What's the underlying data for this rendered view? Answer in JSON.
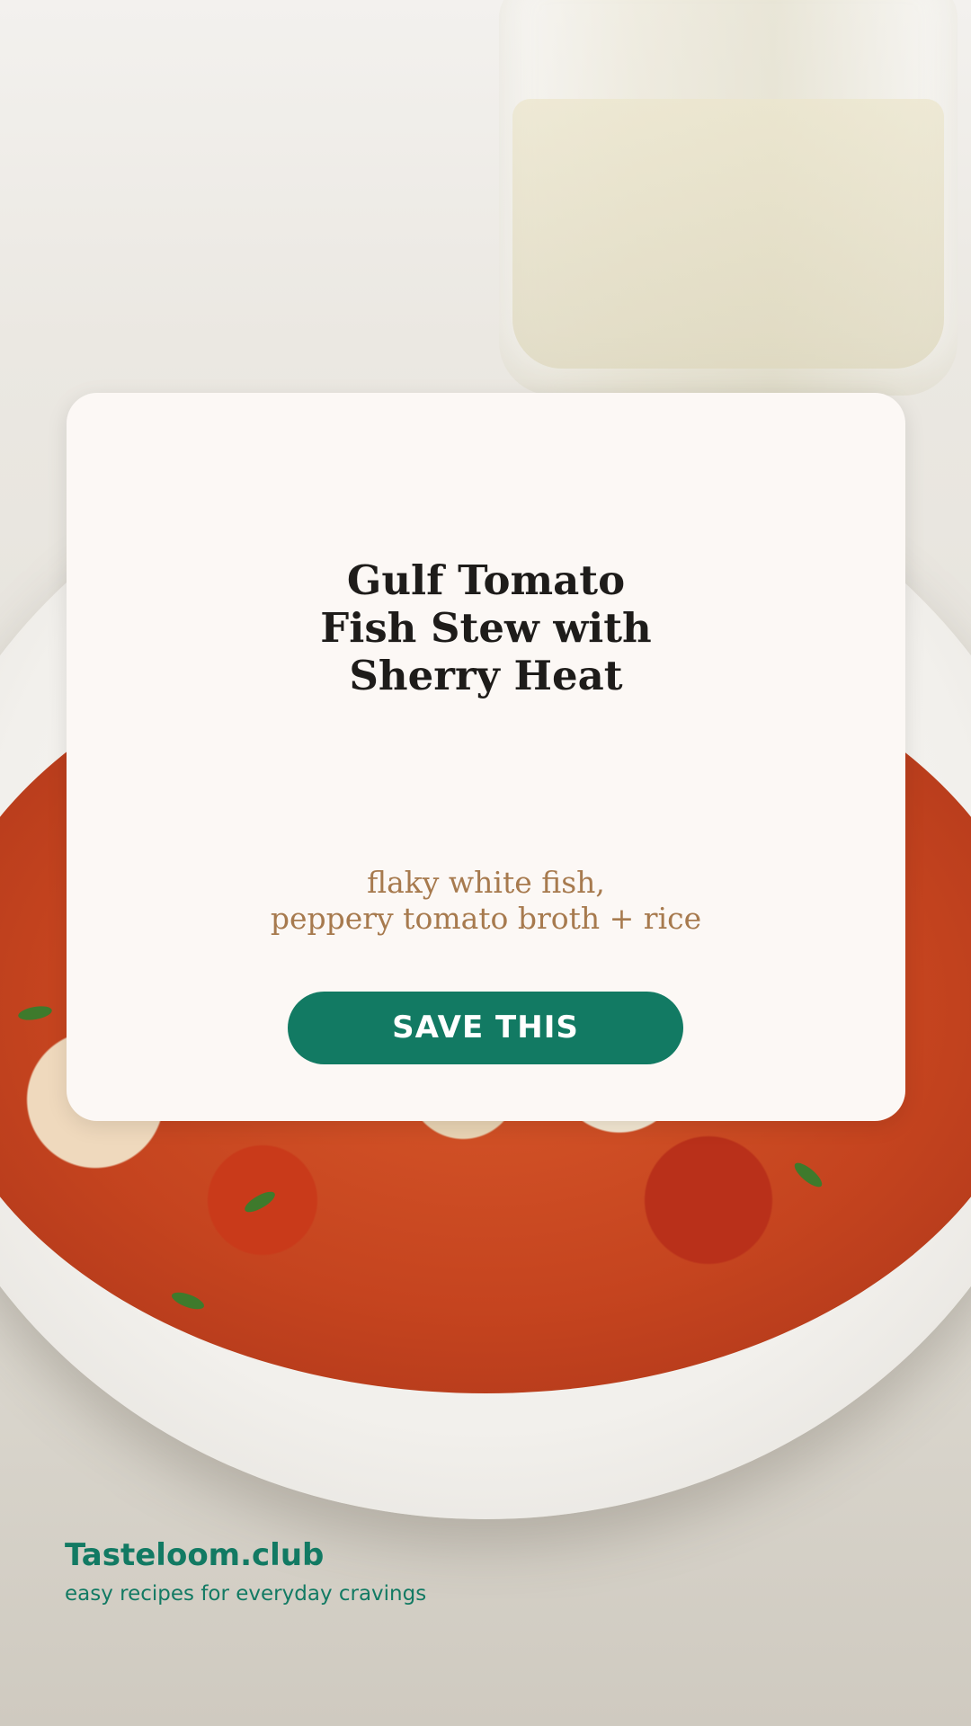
{
  "card": {
    "title_lines": [
      "Gulf Tomato",
      "Fish Stew with",
      "Sherry Heat"
    ],
    "subtitle_lines": [
      "flaky white fish,",
      "peppery tomato broth + rice"
    ],
    "button_label": "SAVE THIS"
  },
  "brand": {
    "name": "Tasteloom.club",
    "tagline": "easy recipes for everyday cravings"
  },
  "colors": {
    "accent": "#127a63",
    "card_background": "#fcf8f5",
    "title_text": "#1e1c1a",
    "subtitle_text": "#a77a4e"
  }
}
